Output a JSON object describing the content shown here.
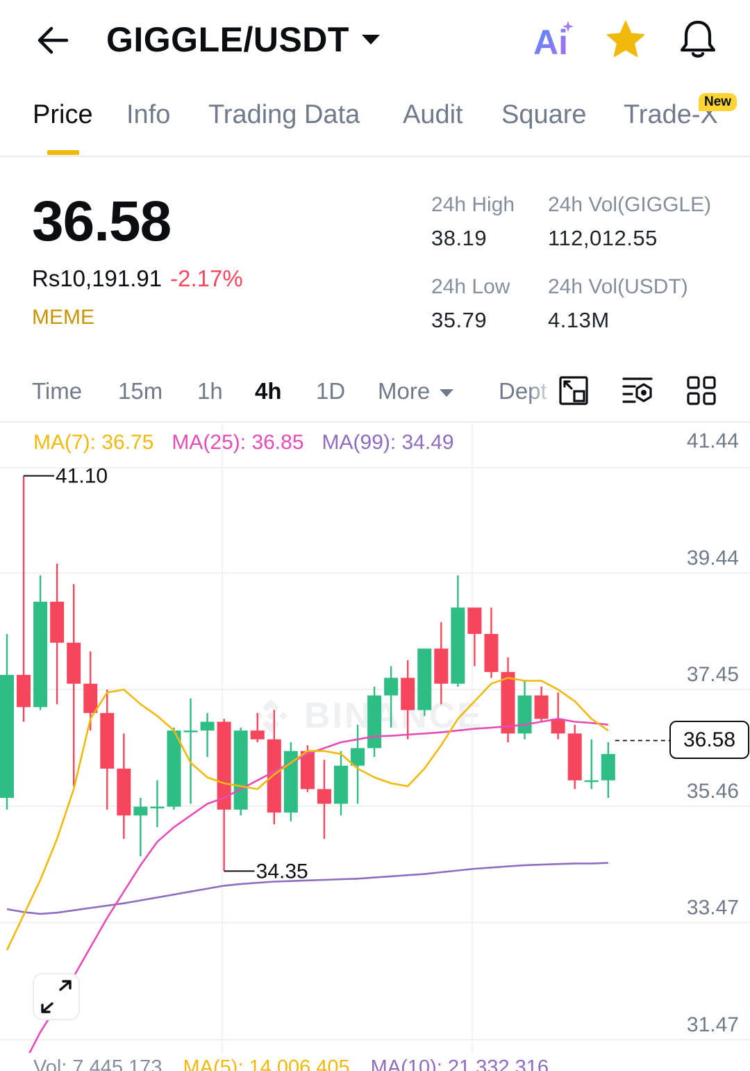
{
  "header": {
    "pair": "GIGGLE/USDT",
    "ai_label": "Ai"
  },
  "tabs": [
    {
      "label": "Price",
      "active": true
    },
    {
      "label": "Info"
    },
    {
      "label": "Trading Data"
    },
    {
      "label": "Audit"
    },
    {
      "label": "Square"
    },
    {
      "label": "Trade-X",
      "badge": "New"
    }
  ],
  "ticker": {
    "last_price": "36.58",
    "fiat_price": "Rs10,191.91",
    "change": "-2.17%",
    "tag": "MEME",
    "high_label": "24h High",
    "high_value": "38.19",
    "low_label": "24h Low",
    "low_value": "35.79",
    "vol_base_label": "24h Vol(GIGGLE)",
    "vol_base_value": "112,012.55",
    "vol_quote_label": "24h Vol(USDT)",
    "vol_quote_value": "4.13M"
  },
  "intervals": {
    "items": [
      "Time",
      "15m",
      "1h",
      "4h",
      "1D",
      "More",
      "Dept"
    ],
    "active": "4h"
  },
  "indicators": {
    "ma7": "MA(7): 36.75",
    "ma25": "MA(25): 36.85",
    "ma99": "MA(99): 34.49"
  },
  "volume": {
    "vol": "Vol: 7,445.173",
    "ma5": "MA(5): 14,006.405",
    "ma10": "MA(10): 21,332.316"
  },
  "colors": {
    "up": "#2ebd85",
    "down": "#f6465d",
    "ma7": "#f0b90b",
    "ma25": "#e54cb5",
    "ma99": "#8e6cc0",
    "accent": "#f0b90b"
  },
  "chart_data": {
    "type": "candlestick",
    "watermark": "BINANCE",
    "y_ticks": [
      "41.44",
      "39.44",
      "37.45",
      "35.46",
      "33.47",
      "31.47"
    ],
    "ylim": [
      31.47,
      41.44
    ],
    "current_price": "36.58",
    "high_marker": "41.10",
    "low_marker": "34.35",
    "candles": [
      {
        "o": 35.6,
        "h": 38.4,
        "l": 35.4,
        "c": 37.7
      },
      {
        "o": 37.7,
        "h": 41.1,
        "l": 36.9,
        "c": 37.15
      },
      {
        "o": 37.15,
        "h": 39.4,
        "l": 37.1,
        "c": 38.95
      },
      {
        "o": 38.95,
        "h": 39.6,
        "l": 37.2,
        "c": 38.25
      },
      {
        "o": 38.25,
        "h": 39.25,
        "l": 35.8,
        "c": 37.55
      },
      {
        "o": 37.55,
        "h": 38.1,
        "l": 36.75,
        "c": 37.05
      },
      {
        "o": 37.05,
        "h": 37.45,
        "l": 35.4,
        "c": 36.1
      },
      {
        "o": 36.1,
        "h": 36.7,
        "l": 34.9,
        "c": 35.3
      },
      {
        "o": 35.3,
        "h": 35.6,
        "l": 34.6,
        "c": 35.45
      },
      {
        "o": 35.45,
        "h": 35.9,
        "l": 35.1,
        "c": 35.45
      },
      {
        "o": 35.45,
        "h": 36.8,
        "l": 35.4,
        "c": 36.75
      },
      {
        "o": 36.75,
        "h": 37.3,
        "l": 35.5,
        "c": 36.75
      },
      {
        "o": 36.75,
        "h": 37.05,
        "l": 36.3,
        "c": 36.9
      },
      {
        "o": 36.9,
        "h": 36.95,
        "l": 34.35,
        "c": 35.4
      },
      {
        "o": 35.4,
        "h": 36.8,
        "l": 35.3,
        "c": 36.75
      },
      {
        "o": 36.75,
        "h": 37.05,
        "l": 36.55,
        "c": 36.6
      },
      {
        "o": 36.6,
        "h": 37.1,
        "l": 35.15,
        "c": 35.35
      },
      {
        "o": 35.35,
        "h": 36.55,
        "l": 35.2,
        "c": 36.4
      },
      {
        "o": 36.4,
        "h": 36.5,
        "l": 35.7,
        "c": 35.75
      },
      {
        "o": 35.75,
        "h": 36.25,
        "l": 34.9,
        "c": 35.5
      },
      {
        "o": 35.5,
        "h": 36.4,
        "l": 35.3,
        "c": 36.15
      },
      {
        "o": 36.15,
        "h": 36.85,
        "l": 35.5,
        "c": 36.45
      },
      {
        "o": 36.45,
        "h": 37.5,
        "l": 36.3,
        "c": 37.35
      },
      {
        "o": 37.35,
        "h": 37.85,
        "l": 36.8,
        "c": 37.65
      },
      {
        "o": 37.65,
        "h": 37.95,
        "l": 36.6,
        "c": 37.1
      },
      {
        "o": 37.1,
        "h": 38.1,
        "l": 37.0,
        "c": 38.15
      },
      {
        "o": 38.15,
        "h": 38.6,
        "l": 37.2,
        "c": 37.55
      },
      {
        "o": 37.55,
        "h": 39.4,
        "l": 37.5,
        "c": 38.85
      },
      {
        "o": 38.85,
        "h": 38.85,
        "l": 37.85,
        "c": 38.4
      },
      {
        "o": 38.4,
        "h": 38.85,
        "l": 37.65,
        "c": 37.75
      },
      {
        "o": 37.75,
        "h": 38.0,
        "l": 36.55,
        "c": 36.7
      },
      {
        "o": 36.7,
        "h": 37.6,
        "l": 36.6,
        "c": 37.35
      },
      {
        "o": 37.35,
        "h": 37.5,
        "l": 36.9,
        "c": 36.95
      },
      {
        "o": 36.95,
        "h": 37.4,
        "l": 36.6,
        "c": 36.7
      },
      {
        "o": 36.7,
        "h": 36.85,
        "l": 35.75,
        "c": 35.9
      },
      {
        "o": 35.9,
        "h": 36.6,
        "l": 35.75,
        "c": 35.9
      },
      {
        "o": 35.9,
        "h": 36.55,
        "l": 35.6,
        "c": 36.35
      }
    ],
    "ma7_series": [
      33.0,
      33.6,
      34.2,
      34.9,
      35.75,
      36.95,
      37.4,
      37.45,
      37.2,
      37.0,
      36.75,
      36.2,
      35.95,
      35.85,
      35.8,
      35.75,
      36.0,
      36.2,
      36.4,
      36.4,
      36.35,
      36.1,
      35.95,
      35.85,
      35.8,
      36.1,
      36.5,
      36.95,
      37.25,
      37.55,
      37.65,
      37.6,
      37.6,
      37.45,
      37.25,
      36.95,
      36.75
    ],
    "ma25_series": [
      30.6,
      31.05,
      31.6,
      32.05,
      32.55,
      33.05,
      33.55,
      34.0,
      34.45,
      34.85,
      35.1,
      35.3,
      35.5,
      35.6,
      35.75,
      35.9,
      36.05,
      36.2,
      36.35,
      36.45,
      36.55,
      36.6,
      36.65,
      36.66,
      36.68,
      36.7,
      36.72,
      36.75,
      36.78,
      36.8,
      36.82,
      36.85,
      36.9,
      36.95,
      36.9,
      36.88,
      36.85
    ],
    "ma99_series": [
      33.7,
      33.65,
      33.62,
      33.64,
      33.68,
      33.72,
      33.76,
      33.8,
      33.85,
      33.9,
      33.95,
      34.0,
      34.05,
      34.1,
      34.13,
      34.15,
      34.17,
      34.18,
      34.19,
      34.2,
      34.21,
      34.22,
      34.24,
      34.26,
      34.28,
      34.3,
      34.33,
      34.36,
      34.39,
      34.41,
      34.43,
      34.45,
      34.46,
      34.47,
      34.48,
      34.48,
      34.49
    ]
  }
}
